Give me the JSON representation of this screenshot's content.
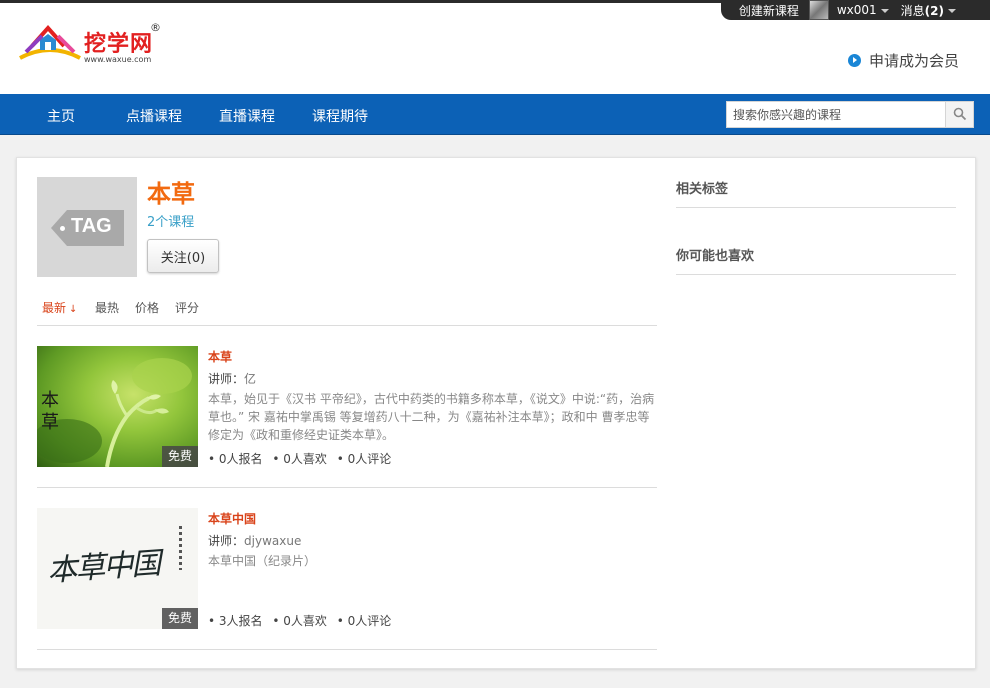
{
  "topbar": {
    "create_course": "创建新课程",
    "username": "wx001",
    "messages_label": "消息",
    "messages_count": "(2)"
  },
  "logo": {
    "name": "挖学网",
    "reg": "®",
    "url": "www.waxue.com"
  },
  "header": {
    "member_link": "申请成为会员"
  },
  "nav": {
    "items": [
      "主页",
      "点播课程",
      "直播课程",
      "课程期待"
    ],
    "search_placeholder": "搜索你感兴趣的课程"
  },
  "tag": {
    "image_text": "TAG",
    "title": "本草",
    "course_count": "2个课程",
    "follow_label": "关注(0)"
  },
  "sort": {
    "items": [
      "最新",
      "最热",
      "价格",
      "评分"
    ],
    "active_arrow": "↓"
  },
  "courses": [
    {
      "title": "本草",
      "teacher_label": "讲师：",
      "teacher": "亿",
      "desc": "本草，始见于《汉书 平帝纪》，古代中药类的书籍多称本草，《说文》中说:“药，治病草也。” 宋 嘉祐中掌禹锡 等复增药八十二种，为《嘉祐补注本草》；政和中 曹孝忠等修定为《政和重修经史证类本草》。",
      "price_badge": "免费",
      "thumb_text": [
        "本",
        "草"
      ],
      "stats": [
        "• 0人报名",
        "• 0人喜欢",
        "• 0人评论"
      ]
    },
    {
      "title": "本草中国",
      "teacher_label": "讲师：",
      "teacher": "djywaxue",
      "desc": "本草中国（纪录片）",
      "price_badge": "免费",
      "thumb_text": "本草中国",
      "stats": [
        "• 3人报名",
        "• 0人喜欢",
        "• 0人评论"
      ]
    }
  ],
  "sidebar": {
    "related_tags": "相关标签",
    "you_may_like": "你可能也喜欢"
  },
  "colors": {
    "nav_blue": "#0c61b6",
    "accent_orange": "#f26a10",
    "title_red": "#d9431a",
    "link_blue": "#3aa0c8"
  }
}
